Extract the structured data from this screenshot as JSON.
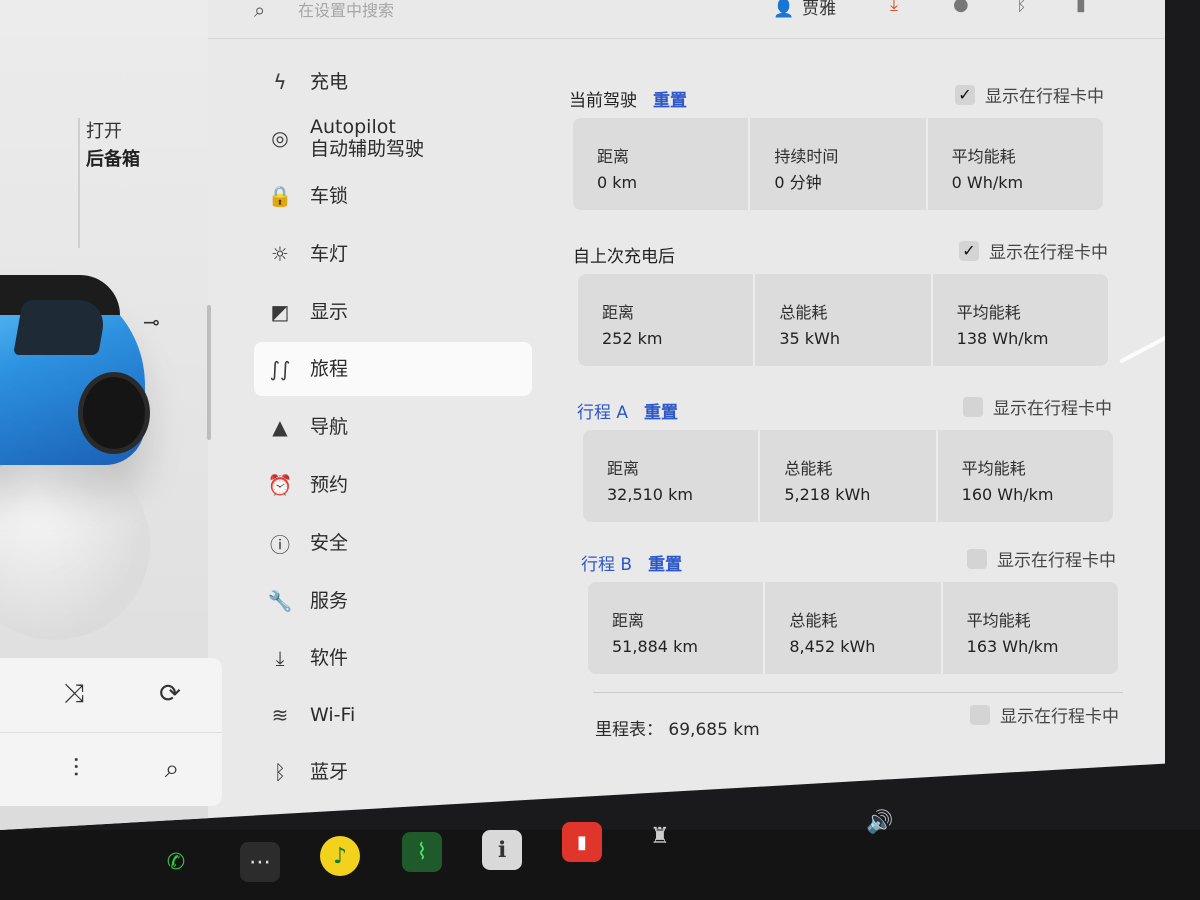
{
  "search": {
    "placeholder": "在设置中搜索"
  },
  "topbar": {
    "user_name": "贾雅"
  },
  "car_panel": {
    "trunk_line1": "打开",
    "trunk_line2": "后备箱"
  },
  "sidebar": {
    "items": [
      {
        "label": "充电",
        "icon": "lightning-icon",
        "glyph": "ϟ"
      },
      {
        "label": "Autopilot",
        "sublabel": "自动辅助驾驶",
        "icon": "steering-wheel-icon",
        "glyph": "◎"
      },
      {
        "label": "车锁",
        "icon": "lock-icon",
        "glyph": "🔒"
      },
      {
        "label": "车灯",
        "icon": "light-icon",
        "glyph": "☼"
      },
      {
        "label": "显示",
        "icon": "display-icon",
        "glyph": "◩"
      },
      {
        "label": "旅程",
        "icon": "trip-icon",
        "glyph": "∫∫",
        "active": true
      },
      {
        "label": "导航",
        "icon": "navigation-icon",
        "glyph": "▲"
      },
      {
        "label": "预约",
        "icon": "alarm-icon",
        "glyph": "⏰"
      },
      {
        "label": "安全",
        "icon": "safety-icon",
        "glyph": "ⓘ"
      },
      {
        "label": "服务",
        "icon": "wrench-icon",
        "glyph": "🔧"
      },
      {
        "label": "软件",
        "icon": "download-icon",
        "glyph": "⤓"
      },
      {
        "label": "Wi-Fi",
        "icon": "wifi-icon",
        "glyph": "≋"
      },
      {
        "label": "蓝牙",
        "icon": "bluetooth-icon",
        "glyph": "ᛒ"
      }
    ]
  },
  "main": {
    "show_label": "显示在行程卡中",
    "reset_label": "重置",
    "sections": [
      {
        "title": "当前驾驶",
        "has_reset": true,
        "checked": true,
        "stats": [
          {
            "label": "距离",
            "value": "0 km"
          },
          {
            "label": "持续时间",
            "value": "0 分钟"
          },
          {
            "label": "平均能耗",
            "value": "0 Wh/km"
          }
        ]
      },
      {
        "title": "自上次充电后",
        "has_reset": false,
        "checked": true,
        "stats": [
          {
            "label": "距离",
            "value": "252 km"
          },
          {
            "label": "总能耗",
            "value": "35 kWh"
          },
          {
            "label": "平均能耗",
            "value": "138 Wh/km"
          }
        ]
      },
      {
        "title": "行程 A",
        "has_reset": true,
        "checked": false,
        "stats": [
          {
            "label": "距离",
            "value": "32,510 km"
          },
          {
            "label": "总能耗",
            "value": "5,218 kWh"
          },
          {
            "label": "平均能耗",
            "value": "160 Wh/km"
          }
        ]
      },
      {
        "title": "行程 B",
        "has_reset": true,
        "checked": false,
        "stats": [
          {
            "label": "距离",
            "value": "51,884 km"
          },
          {
            "label": "总能耗",
            "value": "8,452 kWh"
          },
          {
            "label": "平均能耗",
            "value": "163 Wh/km"
          }
        ]
      }
    ],
    "odometer": {
      "label": "里程表：",
      "value": "69,685 km",
      "checked": false
    }
  },
  "media": {
    "shuffle_icon": "shuffle-icon",
    "repeat_icon": "repeat-icon",
    "equalizer_icon": "equalizer-icon",
    "search_icon": "search-icon"
  },
  "colors": {
    "accent": "#2c57c7",
    "screen_bg": "#e9e9e9",
    "card_bg": "#dcdcdc",
    "active_item_bg": "#fafafa"
  }
}
